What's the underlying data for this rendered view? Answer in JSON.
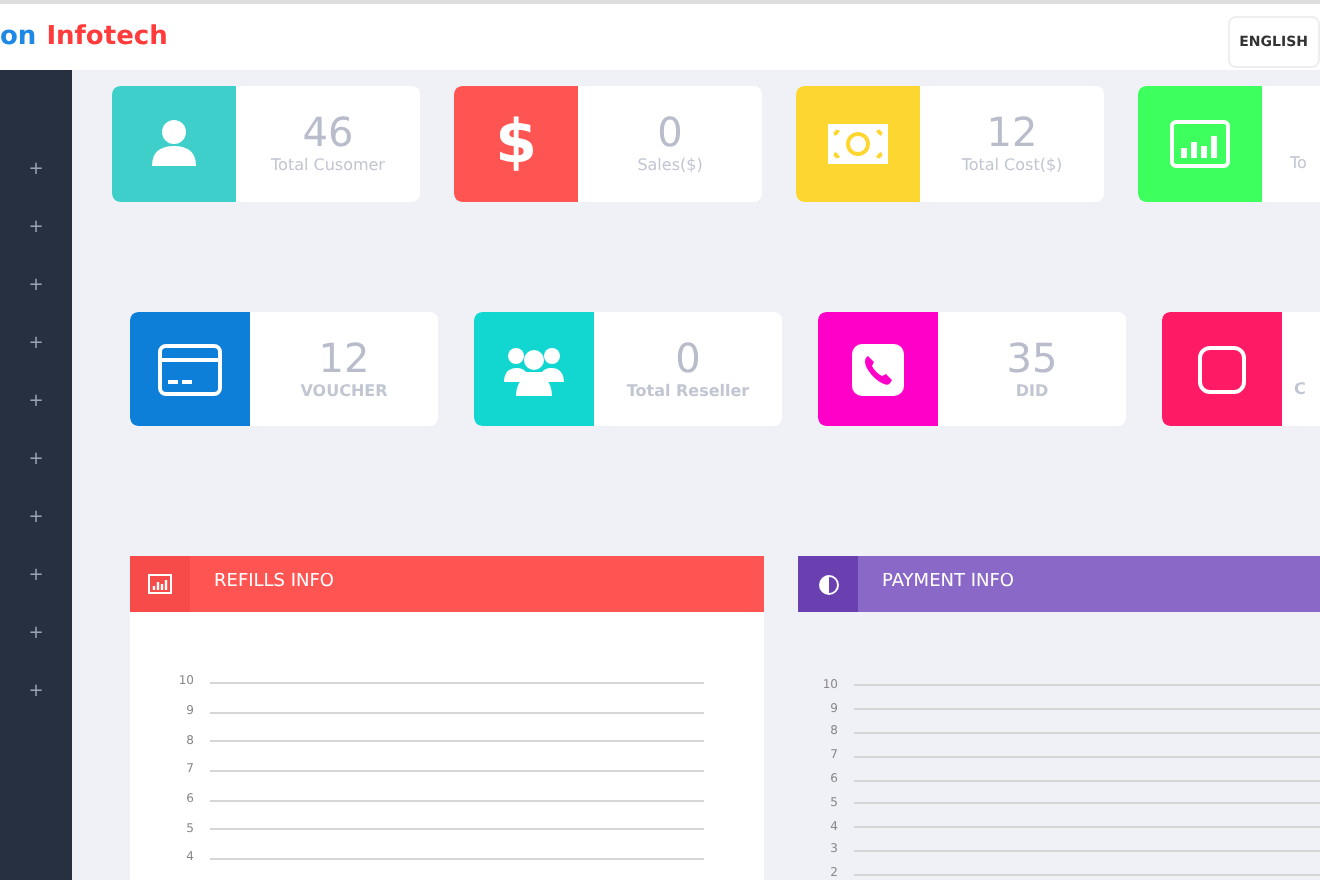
{
  "header": {
    "brand_parts": [
      {
        "text": "on",
        "color": "#1e88e5"
      },
      {
        "text": "Infotech",
        "color": "#ff3b3b"
      }
    ],
    "language_button": "ENGLISH"
  },
  "sidebar": {
    "items": [
      "+",
      "+",
      "+",
      "+",
      "+",
      "+",
      "+",
      "+",
      "+",
      "+"
    ]
  },
  "stat_rows": [
    {
      "bold_labels": false,
      "cards": [
        {
          "value": "46",
          "label": "Total Cusomer",
          "color": "#3ecfcb"
        },
        {
          "value": "0",
          "label": "Sales($)",
          "color": "#ff5552",
          "icon_glyph": "$"
        },
        {
          "value": "12",
          "label": "Total Cost($)",
          "color": "#fdd631"
        },
        {
          "label": "To",
          "color": "#3dff5e"
        }
      ]
    },
    {
      "bold_labels": true,
      "cards": [
        {
          "value": "12",
          "label": "VOUCHER",
          "color": "#0d7fd9"
        },
        {
          "value": "0",
          "label": "Total Reseller",
          "color": "#12d6d0"
        },
        {
          "value": "35",
          "label": "DID",
          "color": "#ff00c8"
        },
        {
          "label": "C",
          "color": "#ff1a66"
        }
      ]
    }
  ],
  "panels": [
    {
      "title": "REFILLS INFO",
      "color": "#ff5552",
      "icon_tile": {
        "color": "#f64b48"
      },
      "y_ticks": [
        "10",
        "9",
        "8",
        "7",
        "6",
        "5",
        "4"
      ]
    },
    {
      "title": "PAYMENT INFO",
      "color": "#8a68c8",
      "icon_tile": {
        "color": "#6a3fb0"
      },
      "y_ticks": [
        "10",
        "9",
        "8",
        "7",
        "6",
        "5",
        "4",
        "3",
        "2"
      ]
    }
  ]
}
